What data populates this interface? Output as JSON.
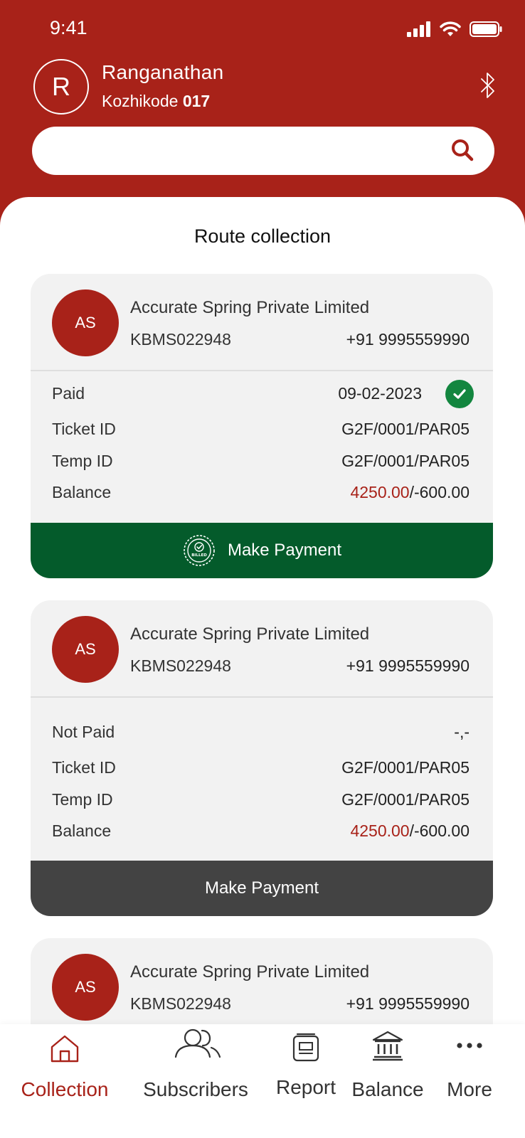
{
  "status_bar": {
    "time": "9:41"
  },
  "user": {
    "initial": "R",
    "name": "Ranganathan",
    "location": "Kozhikode",
    "location_code": "017"
  },
  "search": {
    "placeholder": ""
  },
  "page": {
    "title": "Route collection"
  },
  "colors": {
    "brand": "#a82219",
    "paid_green": "#045b2b",
    "check_green": "#13863f",
    "button_gray": "#434343"
  },
  "cards": [
    {
      "initials": "AS",
      "company": "Accurate Spring Private Limited",
      "code": "KBMS022948",
      "phone": "+91 9995559990",
      "status": "Paid",
      "status_value": "09-02-2023",
      "status_icon": "check-circle-icon",
      "ticket_label": "Ticket ID",
      "ticket_value": "G2F/0001/PAR05",
      "temp_label": "Temp ID",
      "temp_value": "G2F/0001/PAR05",
      "balance_label": "Balance",
      "balance_amount": "4250.00",
      "balance_rest": "/-600.00",
      "button_label": "Make Payment",
      "badge_text": "BILLED"
    },
    {
      "initials": "AS",
      "company": "Accurate Spring Private Limited",
      "code": "KBMS022948",
      "phone": "+91 9995559990",
      "status": "Not Paid",
      "status_value": "-,-",
      "ticket_label": "Ticket ID",
      "ticket_value": "G2F/0001/PAR05",
      "temp_label": "Temp ID",
      "temp_value": "G2F/0001/PAR05",
      "balance_label": "Balance",
      "balance_amount": "4250.00",
      "balance_rest": "/-600.00",
      "button_label": "Make Payment"
    },
    {
      "initials": "AS",
      "company": "Accurate Spring Private Limited",
      "code": "KBMS022948",
      "phone": "+91 9995559990"
    }
  ],
  "nav": [
    {
      "label": "Collection",
      "icon": "home-icon",
      "active": true
    },
    {
      "label": "Subscribers",
      "icon": "users-icon"
    },
    {
      "label": "Report",
      "icon": "report-icon"
    },
    {
      "label": "Balance",
      "icon": "bank-icon"
    },
    {
      "label": "More",
      "icon": "more-icon"
    }
  ]
}
